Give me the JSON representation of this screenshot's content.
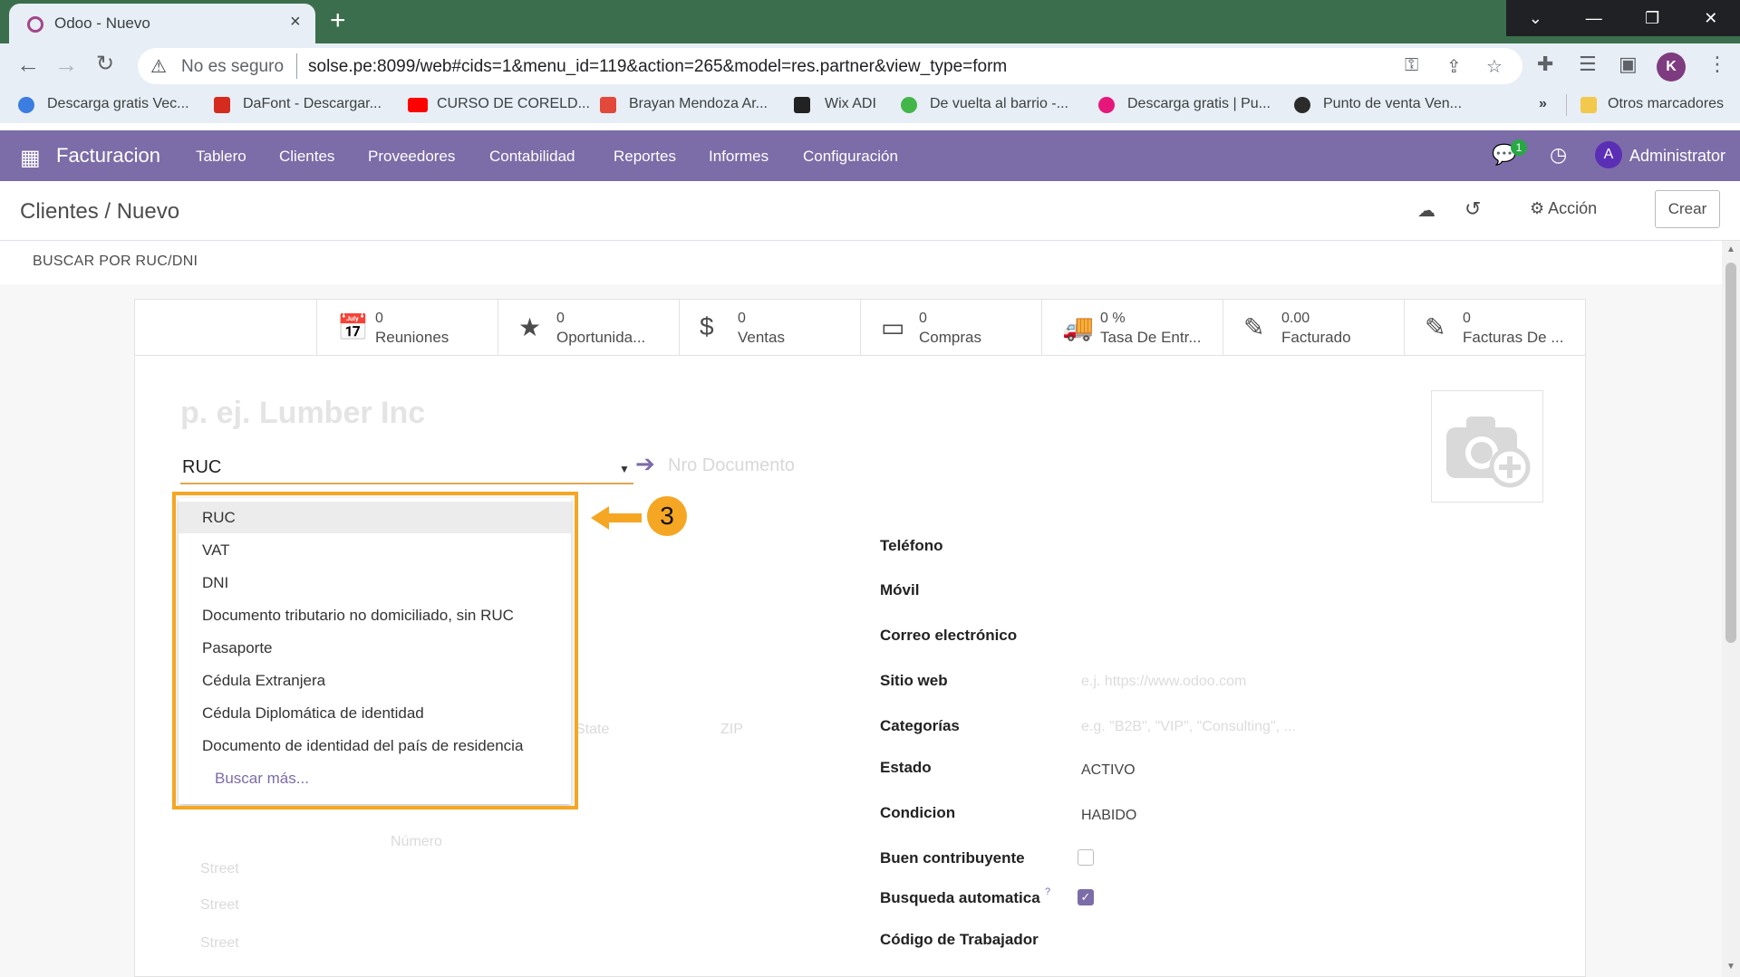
{
  "browser": {
    "tab_title": "Odoo - Nuevo",
    "tab_close": "×",
    "new_tab": "+",
    "not_secure": "No es seguro",
    "url": "solse.pe:8099/web#cids=1&menu_id=119&action=265&model=res.partner&view_type=form",
    "profile_initial": "K",
    "bookmarks": [
      "Descarga gratis Vec...",
      "DaFont - Descargar...",
      "CURSO DE CORELD...",
      "Brayan Mendoza Ar...",
      "Wix ADI",
      "De vuelta al barrio -...",
      "Descarga gratis | Pu...",
      "Punto de venta Ven..."
    ],
    "bookmarks_more": "»",
    "other_bookmarks": "Otros marcadores"
  },
  "navbar": {
    "brand": "Facturacion",
    "menu": [
      "Tablero",
      "Clientes",
      "Proveedores",
      "Contabilidad",
      "Reportes",
      "Informes",
      "Configuración"
    ],
    "chat_count": "1",
    "user_initial": "A",
    "user_name": "Administrator"
  },
  "control": {
    "breadcrumb": "Clientes / Nuevo",
    "action_label": "⚙ Acción",
    "create_label": "Crear"
  },
  "statusbar": {
    "ruc_button": "BUSCAR POR RUC/DNI"
  },
  "smart_buttons": [
    {
      "value": "0",
      "label": "Reuniones"
    },
    {
      "value": "0",
      "label": "Oportunida..."
    },
    {
      "value": "0",
      "label": "Ventas"
    },
    {
      "value": "0",
      "label": "Compras"
    },
    {
      "value": "0 %",
      "label": "Tasa De Entr..."
    },
    {
      "value": "0.00",
      "label": "Facturado"
    },
    {
      "value": "0",
      "label": "Facturas De ..."
    }
  ],
  "form": {
    "name_placeholder": "p. ej. Lumber Inc",
    "doc_type_value": "RUC",
    "doc_number_placeholder": "Nro Documento",
    "faint_state": "State",
    "faint_zip": "ZIP",
    "faint_numero": "Número",
    "faint_street": "Street",
    "right_fields": {
      "telefono": "Teléfono",
      "movil": "Móvil",
      "correo": "Correo electrónico",
      "sitio_web": "Sitio web",
      "sitio_web_ph": "e.j. https://www.odoo.com",
      "categorias": "Categorías",
      "categorias_ph": "e.g. \"B2B\", \"VIP\", \"Consulting\", ...",
      "estado": "Estado",
      "estado_value": "ACTIVO",
      "condicion": "Condicion",
      "condicion_value": "HABIDO",
      "buen_contribuyente": "Buen contribuyente",
      "busqueda_automatica": "Busqueda automatica",
      "busqueda_sup": "?",
      "codigo_trabajador": "Código de Trabajador"
    }
  },
  "dropdown": {
    "items": [
      "RUC",
      "VAT",
      "DNI",
      "Documento tributario no domiciliado, sin RUC",
      "Pasaporte",
      "Cédula Extranjera",
      "Cédula Diplomática de identidad",
      "Documento de identidad del país de residencia"
    ],
    "more": "Buscar más..."
  },
  "callout": {
    "number": "3"
  },
  "colors": {
    "odoo_purple": "#7c6ca8",
    "callout_orange": "#f5a623",
    "browser_frame": "#3b6e4d"
  }
}
